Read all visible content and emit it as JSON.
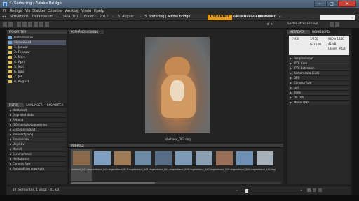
{
  "window": {
    "title": "4. Sortering | Adobe Bridge",
    "min": "–",
    "max": "□",
    "close": "✕"
  },
  "menu": [
    "Fil",
    "Redigér",
    "Vis",
    "Stakker",
    "Etiketter",
    "Værktøj",
    "Vindu",
    "Hjælp"
  ],
  "path": [
    "Skrivebord",
    "Datamaskin",
    "DATA (D:)",
    "Bilder",
    "2012",
    "6. August",
    "3. Sortering | Adobe Bridge"
  ],
  "workspaces": [
    "UTDANNET",
    "GRUNNLEGGENDE",
    "FILMBÅND"
  ],
  "search_placeholder": "",
  "toolbar": {
    "sort_label": "Sorter etter Filnavn"
  },
  "left": {
    "favorites_tab": "FAVORITTER",
    "favorites": [
      {
        "label": "Datamaskin",
        "icon": "computer"
      },
      {
        "label": "Skrivebord",
        "icon": "desktop"
      },
      {
        "label": "1. Januar",
        "icon": "folder"
      },
      {
        "label": "2. Februar",
        "icon": "folder"
      },
      {
        "label": "3. Mars",
        "icon": "folder"
      },
      {
        "label": "4. April",
        "icon": "folder"
      },
      {
        "label": "5. Mai",
        "icon": "folder"
      },
      {
        "label": "6. Juni",
        "icon": "folder"
      },
      {
        "label": "7. Juli",
        "icon": "folder"
      },
      {
        "label": "8. August",
        "icon": "folder"
      }
    ],
    "filter_tabs": [
      "FILTER",
      "SAMLINGER",
      "EKSPORTER"
    ],
    "filters": [
      "Nøkkelord",
      "Opprettet data",
      "Retning",
      "ISO-hastighetsgradering",
      "Eksponeringstid",
      "Blenderåpning",
      "Brennvidde",
      "Objektiv",
      "Modell",
      "Serienummer",
      "Hvitbalanse",
      "Camera Raw",
      "Protokoll om copyright"
    ]
  },
  "preview": {
    "tab": "FORHÅNDSVISNING",
    "caption": "shetland_003.dng",
    "dots": "• • • • •"
  },
  "content": {
    "tab": "INNHOLD",
    "thumbs": [
      {
        "name": "shetland_001.dng",
        "color": "#8a6a4a"
      },
      {
        "name": "shetland_002.dng",
        "color": "#7fa0c0"
      },
      {
        "name": "shetland_003.dng",
        "color": "#a07b58"
      },
      {
        "name": "shetland_004.dng",
        "color": "#6d8aa4"
      },
      {
        "name": "shetland_005.dng",
        "color": "#576d86"
      },
      {
        "name": "shetland_006.dng",
        "color": "#7d9ab6"
      },
      {
        "name": "shetland_007.dng",
        "color": "#8aa0b2"
      },
      {
        "name": "shetland_008.dng",
        "color": "#9a6f5a"
      },
      {
        "name": "shetland_009.dng",
        "color": "#6f90b5"
      },
      {
        "name": "shetland_010.dng",
        "color": "#a5b0b8"
      }
    ]
  },
  "right": {
    "tabs": [
      "METADATA",
      "NØKKELORD"
    ],
    "camera": {
      "aperture": "ƒ/ 4,0",
      "shutter": "1/250",
      "iso": "ISO 100",
      "dims": "960 x 1440",
      "size": "41 kB",
      "colorspace": "Ukjent",
      "color": "RGB"
    },
    "sections": [
      "Filegenskaper",
      "IPTC Core",
      "IPTC Extension",
      "Kameradata (Exif)",
      "GPS",
      "Camera Raw",
      "Lyd",
      "Bilde",
      "DICOM",
      "Model DNF"
    ]
  },
  "status": {
    "text": "27 elementer, 1 valgt - 41 kB"
  }
}
